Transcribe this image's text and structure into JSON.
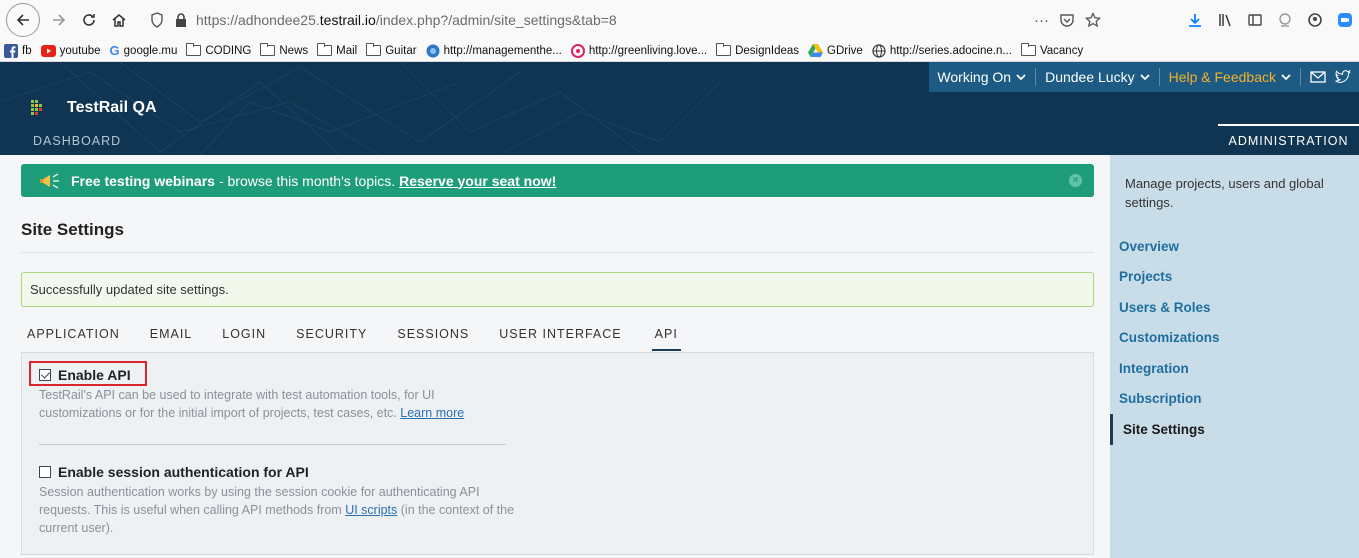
{
  "browser": {
    "url_prefix": "https://adhondee25.",
    "url_domain": "testrail.io",
    "url_path": "/index.php?/admin/site_settings&tab=8",
    "url_menu": "···",
    "bookmarks": [
      {
        "label": "fb",
        "icon": "facebook-icon"
      },
      {
        "label": "youtube",
        "icon": "youtube-icon"
      },
      {
        "label": "google.mu",
        "icon": "google-icon"
      },
      {
        "label": "CODING",
        "icon": "folder-icon"
      },
      {
        "label": "News",
        "icon": "folder-icon"
      },
      {
        "label": "Mail",
        "icon": "folder-icon"
      },
      {
        "label": "Guitar",
        "icon": "folder-icon"
      },
      {
        "label": "http://managementhe...",
        "icon": "globe-icon"
      },
      {
        "label": "http://greenliving.love...",
        "icon": "pin-icon"
      },
      {
        "label": "DesignIdeas",
        "icon": "folder-icon"
      },
      {
        "label": "GDrive",
        "icon": "drive-icon"
      },
      {
        "label": "http://series.adocine.n...",
        "icon": "globe-icon"
      },
      {
        "label": "Vacancy",
        "icon": "folder-icon"
      }
    ]
  },
  "header": {
    "brand": "TestRail QA",
    "working_on": "Working On",
    "user": "Dundee Lucky",
    "help": "Help & Feedback",
    "dashboard": "DASHBOARD",
    "administration": "ADMINISTRATION"
  },
  "banner": {
    "bold": "Free testing webinars",
    "rest": "- browse this month's topics.",
    "cta": "Reserve your seat now!",
    "close": "×"
  },
  "page": {
    "title": "Site Settings",
    "success": "Successfully updated site settings."
  },
  "tabs": [
    {
      "label": "APPLICATION"
    },
    {
      "label": "EMAIL"
    },
    {
      "label": "LOGIN"
    },
    {
      "label": "SECURITY"
    },
    {
      "label": "SESSIONS"
    },
    {
      "label": "USER INTERFACE"
    },
    {
      "label": "API",
      "active": true
    }
  ],
  "api": {
    "enable_label": "Enable API",
    "enable_checked": true,
    "enable_desc": "TestRail's API can be used to integrate with test automation tools, for UI customizations or for the initial import of projects, test cases, etc.",
    "learn_more": "Learn more",
    "session_label": "Enable session authentication for API",
    "session_checked": false,
    "session_desc_1": "Session authentication works by using the session cookie for authenticating API requests. This is useful when calling API methods from",
    "ui_scripts": "UI scripts",
    "session_desc_2": "(in the context of the current user)."
  },
  "sidebar": {
    "description": "Manage projects, users and global settings.",
    "items": [
      {
        "label": "Overview"
      },
      {
        "label": "Projects"
      },
      {
        "label": "Users & Roles"
      },
      {
        "label": "Customizations"
      },
      {
        "label": "Integration"
      },
      {
        "label": "Subscription"
      },
      {
        "label": "Site Settings",
        "active": true
      }
    ]
  }
}
